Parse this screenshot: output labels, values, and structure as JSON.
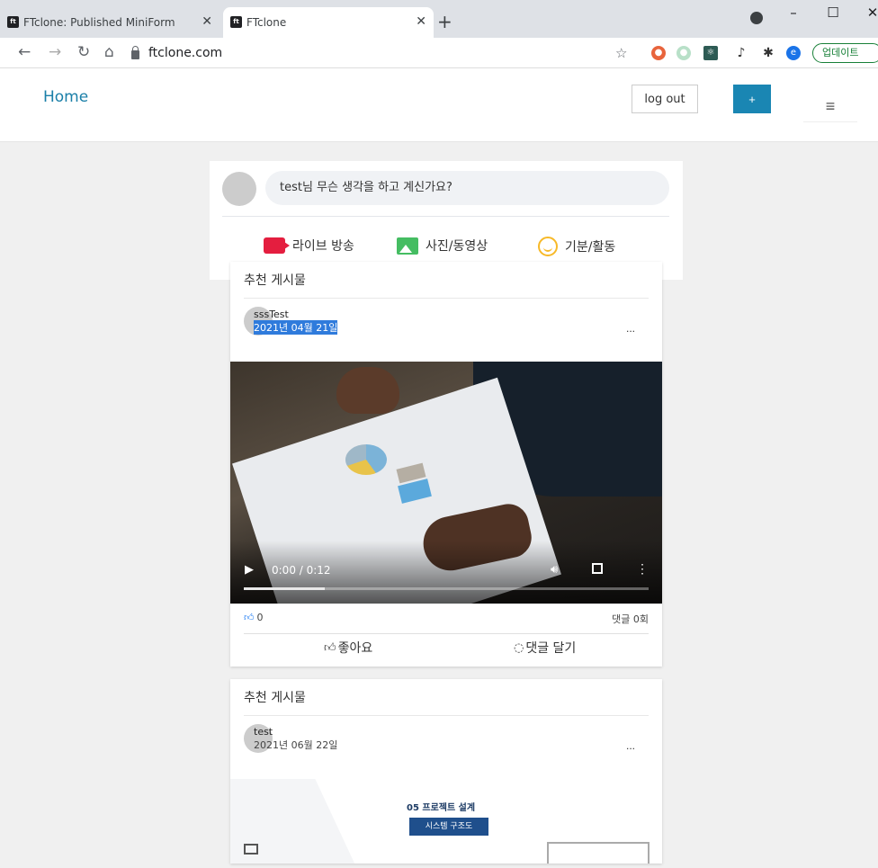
{
  "browser": {
    "tabs": [
      {
        "title": "FTclone: Published MiniForm",
        "favicon": "ft"
      },
      {
        "title": "FTclone",
        "favicon": "ft"
      }
    ],
    "url": "ftclone.com",
    "update_label": "업데이트"
  },
  "header": {
    "home": "Home",
    "logout": "log out",
    "plus": "+",
    "menu_icon": "≡"
  },
  "composer": {
    "prompt": "test님 무슨 생각을 하고 계신가요?",
    "actions": [
      {
        "label": "라이브 방송",
        "icon": "video-camera-icon",
        "color": "#e41e3f"
      },
      {
        "label": "사진/동영상",
        "icon": "photo-icon",
        "color": "#45bd62"
      },
      {
        "label": "기분/활동",
        "icon": "smiley-icon",
        "color": "#f7b928"
      }
    ]
  },
  "posts": [
    {
      "section": "추천 게시물",
      "author": "sssTest",
      "date": "2021년 04월 21일",
      "more": "...",
      "video": {
        "time": "0:00 / 0:12",
        "progress": 0.2
      },
      "likes": "0",
      "comments": "댓글 0회",
      "like_label": "좋아요",
      "comment_label": "댓글 달기"
    },
    {
      "section": "추천 게시물",
      "author": "test",
      "date": "2021년 06월 22일",
      "more": "...",
      "slide_title": "05 프로젝트 설계",
      "slide_tag": "시스템 구조도"
    }
  ]
}
